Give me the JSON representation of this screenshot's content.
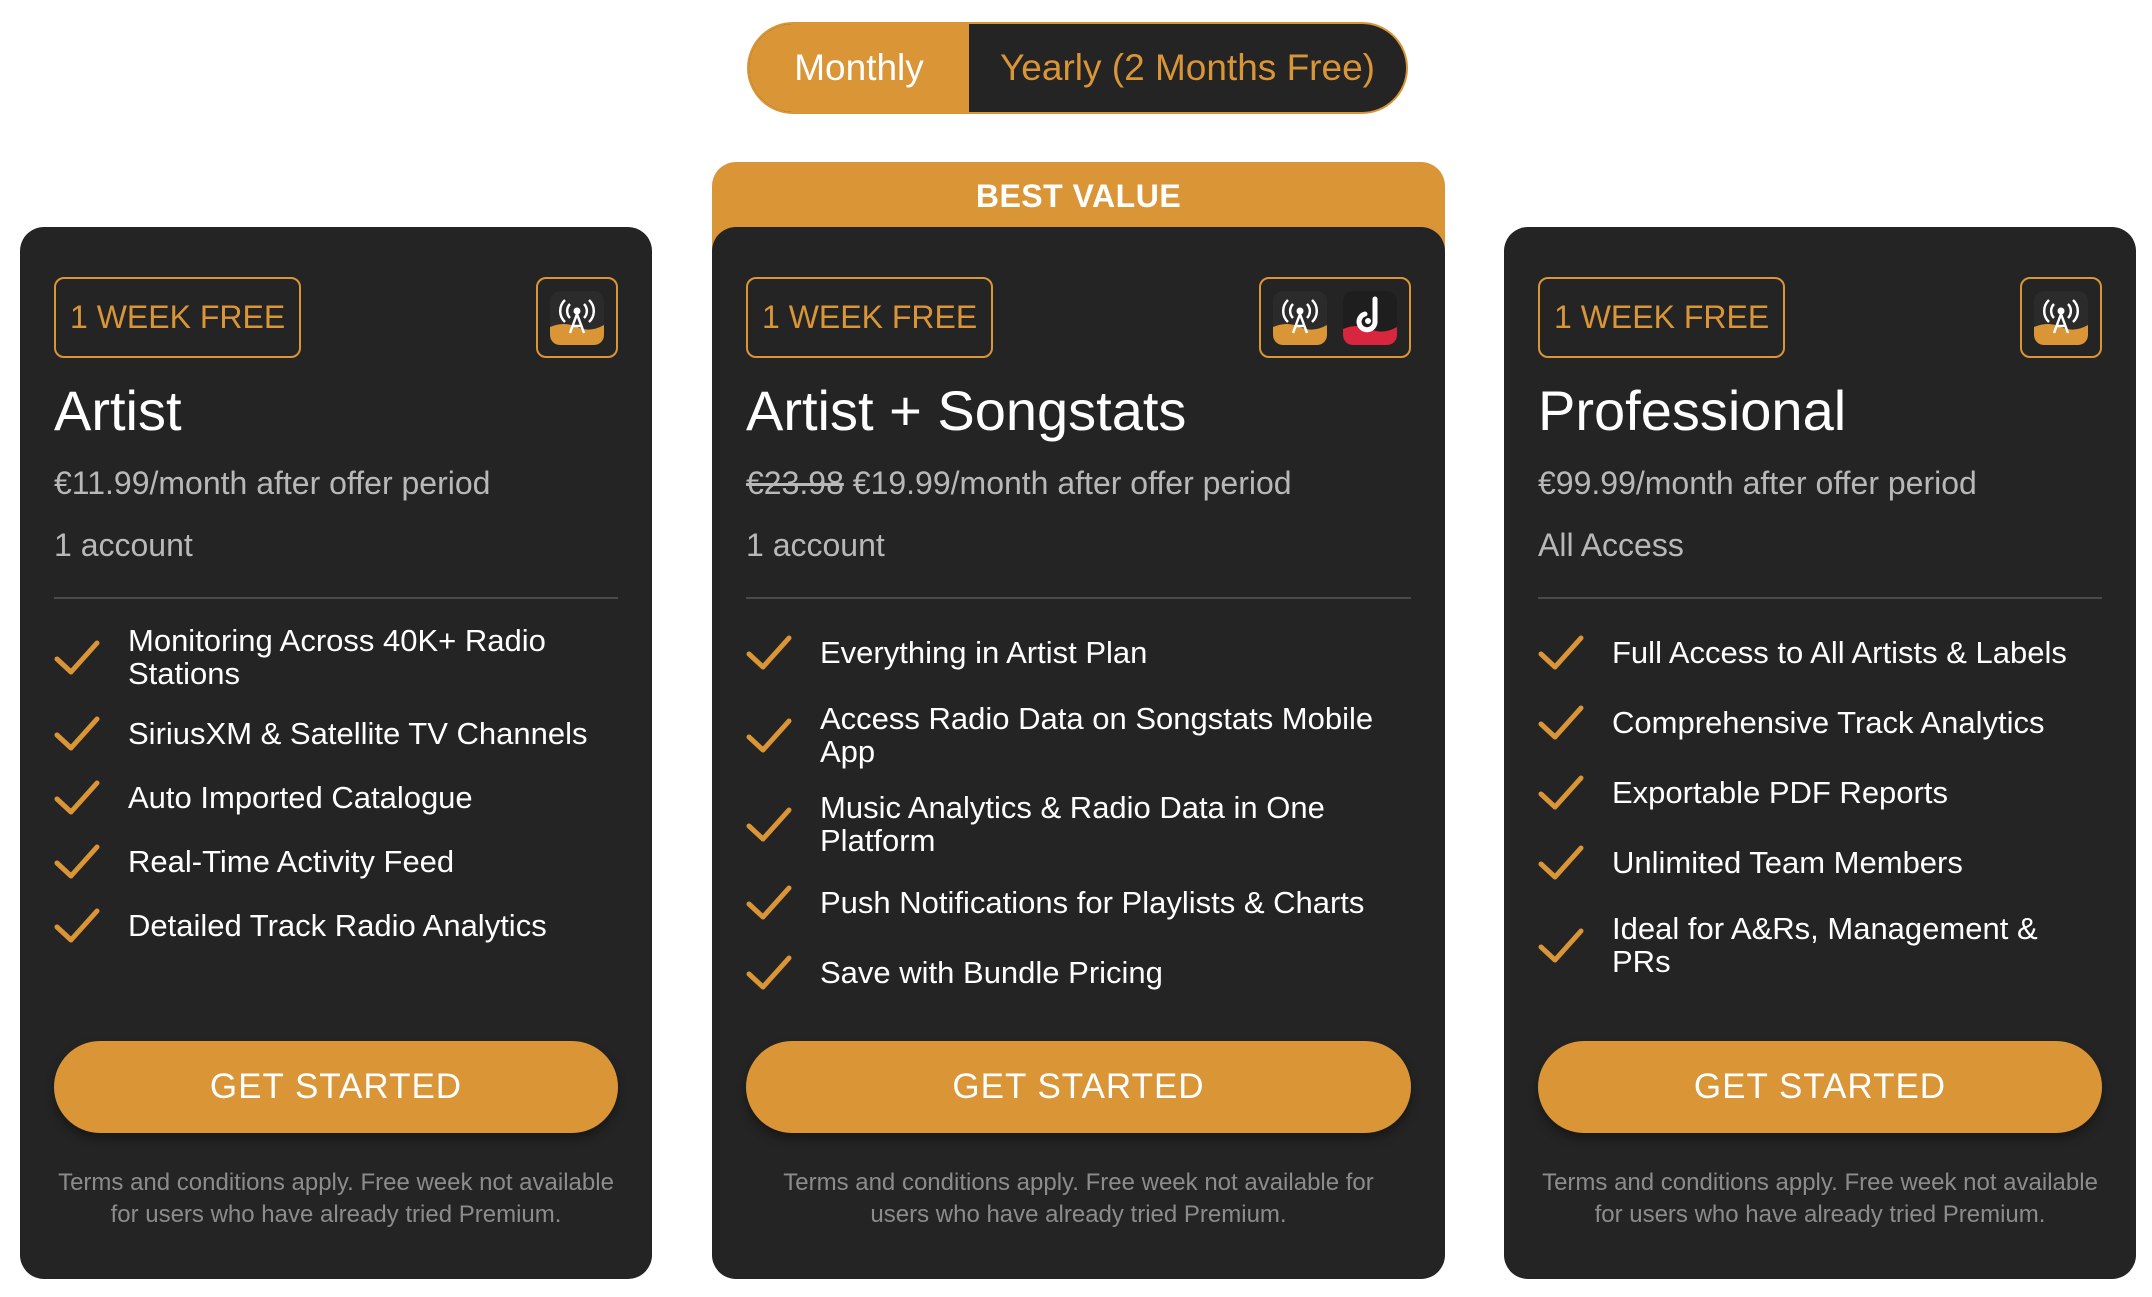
{
  "billing_toggle": {
    "monthly_label": "Monthly",
    "yearly_label": "Yearly (2 Months Free)",
    "selected": "Monthly"
  },
  "best_value_label": "BEST VALUE",
  "colors": {
    "accent": "#da9537",
    "card_bg": "#242424",
    "muted_text": "#b8b8b8",
    "songstats_red": "#d7263d"
  },
  "plans": [
    {
      "badge": "1 WEEK FREE",
      "icons": [
        "radio-tower-icon"
      ],
      "name": "Artist",
      "price_old": "",
      "price": "€11.99/month after offer period",
      "accounts": "1 account",
      "features": [
        "Monitoring Across 40K+ Radio Stations",
        "SiriusXM & Satellite TV Channels",
        "Auto Imported Catalogue",
        "Real-Time Activity Feed",
        "Detailed Track Radio Analytics"
      ],
      "cta": "GET STARTED",
      "terms": "Terms and conditions apply. Free week not available for users who have already tried Premium."
    },
    {
      "badge": "1 WEEK FREE",
      "icons": [
        "radio-tower-icon",
        "songstats-logo-icon"
      ],
      "name": "Artist + Songstats",
      "price_old": "€23.98",
      "price": "€19.99/month after offer period",
      "accounts": "1 account",
      "features": [
        "Everything in Artist Plan",
        "Access Radio Data on Songstats Mobile App",
        "Music Analytics & Radio Data in One Platform",
        "Push Notifications for Playlists & Charts",
        "Save with Bundle Pricing"
      ],
      "cta": "GET STARTED",
      "terms": "Terms and conditions apply. Free week not available for users who have already tried Premium."
    },
    {
      "badge": "1 WEEK FREE",
      "icons": [
        "radio-tower-icon"
      ],
      "name": "Professional",
      "price_old": "",
      "price": "€99.99/month after offer period",
      "accounts": "All Access",
      "features": [
        "Full Access to All Artists & Labels",
        "Comprehensive Track Analytics",
        "Exportable PDF Reports",
        "Unlimited Team Members",
        "Ideal for A&Rs, Management & PRs"
      ],
      "cta": "GET STARTED",
      "terms": "Terms and conditions apply. Free week not available for users who have already tried Premium."
    }
  ]
}
